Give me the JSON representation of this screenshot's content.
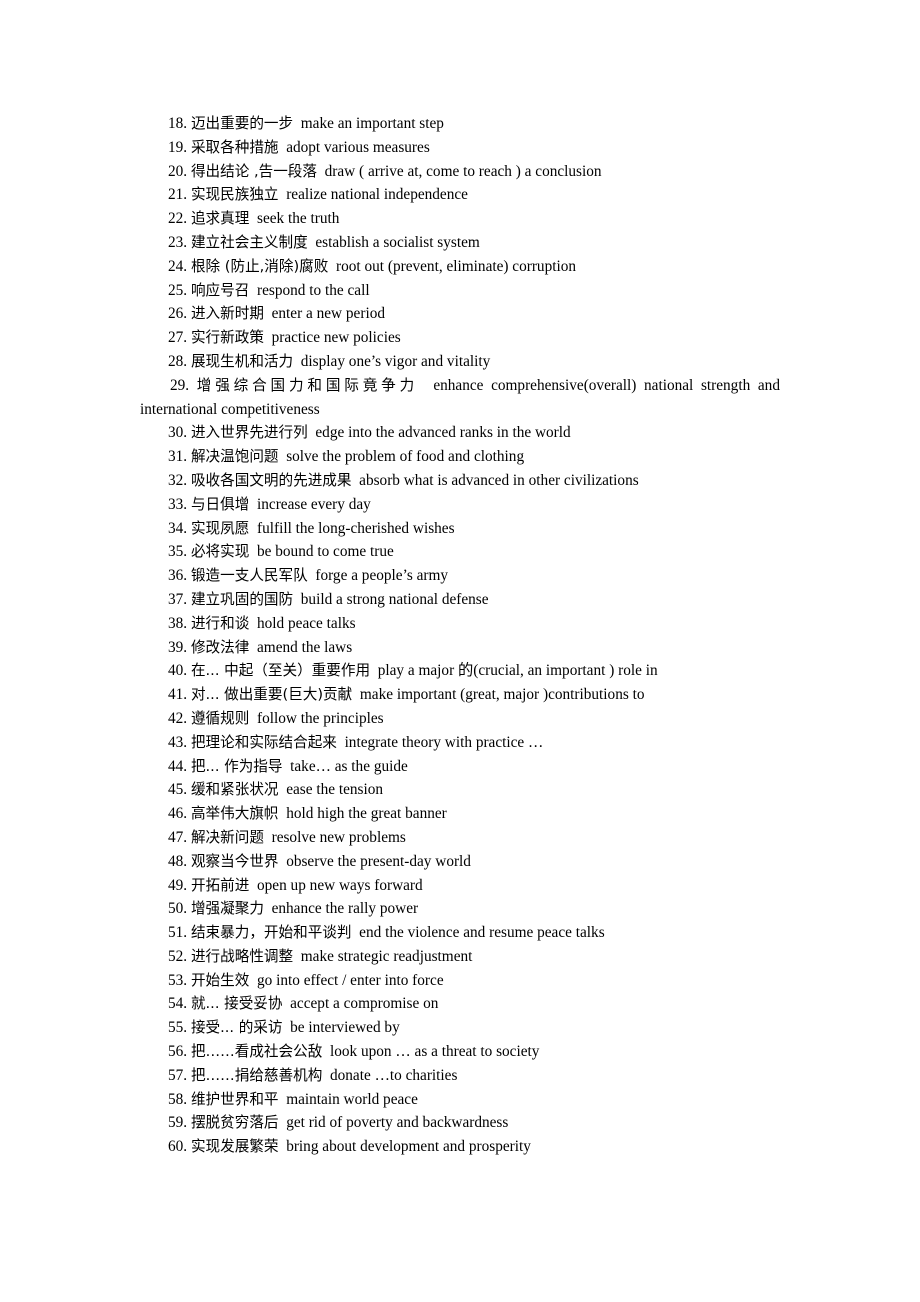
{
  "document": {
    "type": "vocabulary-list",
    "page_background": "#ffffff",
    "text_color": "#000000",
    "first_item_number": 18,
    "last_item_number": 60,
    "items": [
      {
        "num": "18.",
        "zh": "迈出重要的一步",
        "en": "make an important step"
      },
      {
        "num": "19.",
        "zh": "采取各种措施",
        "en": "adopt various measures"
      },
      {
        "num": "20.",
        "zh": "得出结论 ,告一段落",
        "en": "draw ( arrive at, come to reach ) a conclusion"
      },
      {
        "num": "21.",
        "zh": "实现民族独立",
        "en": "realize national independence"
      },
      {
        "num": "22.",
        "zh": "追求真理",
        "en": "seek the truth"
      },
      {
        "num": "23.",
        "zh": "建立社会主义制度",
        "en": "establish a socialist system"
      },
      {
        "num": "24.",
        "zh": "根除 (防止,消除)腐败",
        "en": "root out (prevent, eliminate) corruption"
      },
      {
        "num": "25.",
        "zh": "响应号召",
        "en": "respond to the call"
      },
      {
        "num": "26.",
        "zh": "进入新时期",
        "en": "enter a new period"
      },
      {
        "num": "27.",
        "zh": "实行新政策",
        "en": "practice new policies"
      },
      {
        "num": "28.",
        "zh": "展现生机和活力",
        "en": "display one’s vigor and vitality"
      },
      {
        "num": "29.",
        "zh": "增强综合国力和国际竟争力",
        "en": "enhance comprehensive(overall) national strength and international competitiveness",
        "wraps": true
      },
      {
        "num": "30.",
        "zh": "进入世界先进行列",
        "en": "edge into the advanced ranks in the world"
      },
      {
        "num": "31.",
        "zh": "解决温饱问题",
        "en": "solve the problem of food and clothing"
      },
      {
        "num": "32.",
        "zh": "吸收各国文明的先进成果",
        "en": "absorb what is advanced in other civilizations"
      },
      {
        "num": "33.",
        "zh": "与日俱增",
        "en": "increase every day"
      },
      {
        "num": "34.",
        "zh": "实现夙愿",
        "en": "fulfill the long-cherished wishes"
      },
      {
        "num": "35.",
        "zh": "必将实现",
        "en": "be bound to come true"
      },
      {
        "num": "36.",
        "zh": "锻造一支人民军队",
        "en": "forge a people’s army"
      },
      {
        "num": "37.",
        "zh": "建立巩固的国防",
        "en": "build a strong national defense"
      },
      {
        "num": "38.",
        "zh": "进行和谈",
        "en": "hold peace talks"
      },
      {
        "num": "39.",
        "zh": "修改法律",
        "en": "amend the laws"
      },
      {
        "num": "40.",
        "zh": "在... 中起（至关）重要作用",
        "en": "play a major 的(crucial, an important ) role in"
      },
      {
        "num": "41.",
        "zh": "对... 做出重要(巨大)贡献",
        "en": "make important (great, major )contributions to"
      },
      {
        "num": "42.",
        "zh": "遵循规则",
        "en": "follow the principles"
      },
      {
        "num": "43.",
        "zh": "把理论和实际结合起来",
        "en": "integrate theory with practice …"
      },
      {
        "num": "44.",
        "zh": "把... 作为指导",
        "en": "take… as the guide"
      },
      {
        "num": "45.",
        "zh": "缓和紧张状况",
        "en": "ease the tension"
      },
      {
        "num": "46.",
        "zh": "高举伟大旗帜",
        "en": "hold high the great banner"
      },
      {
        "num": "47.",
        "zh": "解决新问题",
        "en": "resolve new problems"
      },
      {
        "num": "48.",
        "zh": "观察当今世界",
        "en": "observe the present-day world"
      },
      {
        "num": "49.",
        "zh": "开拓前进",
        "en": "open up new ways forward"
      },
      {
        "num": "50.",
        "zh": "增强凝聚力",
        "en": "enhance the rally power"
      },
      {
        "num": "51.",
        "zh": "结束暴力，开始和平谈判",
        "en": "end the violence and resume peace talks"
      },
      {
        "num": "52.",
        "zh": "进行战略性调整",
        "en": "make strategic readjustment"
      },
      {
        "num": "53.",
        "zh": "开始生效",
        "en": "go into effect / enter into force"
      },
      {
        "num": "54.",
        "zh": "就... 接受妥协",
        "en": "accept a compromise on"
      },
      {
        "num": "55.",
        "zh": "接受... 的采访",
        "en": "be interviewed by"
      },
      {
        "num": "56.",
        "zh": "把……看成社会公敌",
        "en": "look upon … as a threat to society"
      },
      {
        "num": "57.",
        "zh": "把……捐给慈善机构",
        "en": "donate …to charities"
      },
      {
        "num": "58.",
        "zh": "维护世界和平",
        "en": "maintain world peace"
      },
      {
        "num": "59.",
        "zh": "摆脱贫穷落后",
        "en": "get rid of poverty and backwardness"
      },
      {
        "num": "60.",
        "zh": "实现发展繁荣",
        "en": "bring about development and prosperity"
      }
    ]
  }
}
